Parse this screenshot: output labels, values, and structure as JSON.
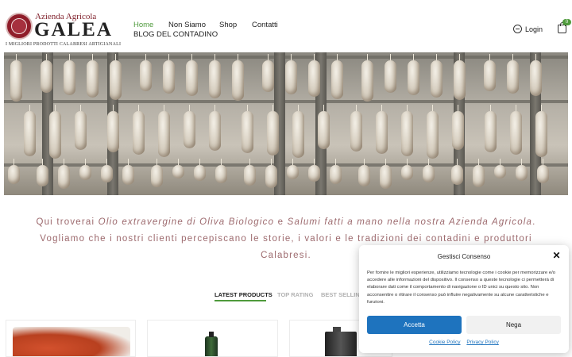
{
  "logo": {
    "top_text": "Azienda Agricola",
    "main_text": "GALEA",
    "sub_text": "I MIGLIORI PRODOTTI CALABRESI ARTIGIANALI"
  },
  "nav": {
    "items": [
      "Home",
      "Non Siamo",
      "Shop",
      "Contatti",
      "BLOG DEL CONTADINO"
    ],
    "active": "Home"
  },
  "header": {
    "login_label": "Login",
    "cart_count": "0"
  },
  "tagline": {
    "part1": "Qui troverai ",
    "em1": "Olio extravergine di Oliva Biologico",
    "part2": " e ",
    "em2": "Salumi fatti a mano nella nostra Azienda Agricola",
    "part3": ". Vogliamo che i nostri clienti percepiscano le storie, i valori  e le tradizioni dei contadini e produttori Calabresi."
  },
  "tabs": [
    "LATEST PRODUCTS",
    "TOP RATING",
    "BEST SELLING"
  ],
  "consent": {
    "title": "Gestisci Consenso",
    "text": "Per fornire le migliori esperienze, utilizziamo tecnologie come i cookie per memorizzare e/o accedere alle informazioni del dispositivo. Il consenso a queste tecnologie ci permetterà di elaborare dati come il comportamento di navigazione o ID unici su questo sito. Non acconsentire o ritirare il consenso può influire negativamente su alcune caratteristiche e funzioni.",
    "accept_label": "Accetta",
    "deny_label": "Nega",
    "cookie_policy_label": "Cookie Policy",
    "privacy_policy_label": "Privacy Policy"
  },
  "colors": {
    "accent": "#4f9a3c",
    "tagline": "#9d6a6e",
    "accept_button": "#1e73be"
  }
}
